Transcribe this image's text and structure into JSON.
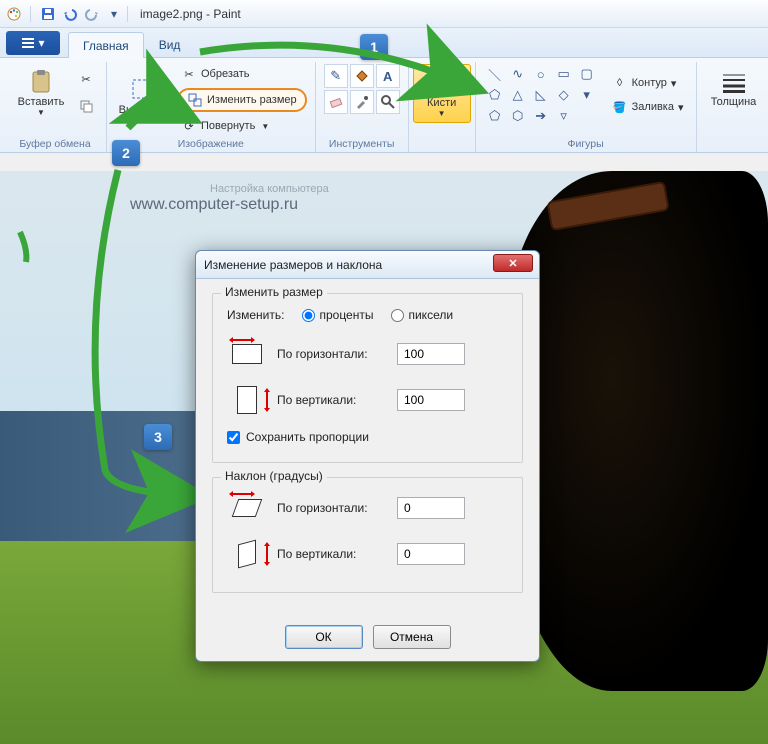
{
  "titlebar": {
    "filename": "image2.png",
    "app": "Paint"
  },
  "tabs": {
    "home": "Главная",
    "view": "Вид"
  },
  "ribbon": {
    "clipboard": {
      "paste": "Вставить",
      "group_label": "Буфер обмена"
    },
    "image": {
      "select": "Выделить",
      "crop": "Обрезать",
      "resize": "Изменить размер",
      "rotate": "Повернуть",
      "group_label": "Изображение"
    },
    "tools": {
      "group_label": "Инструменты"
    },
    "brushes": {
      "label": "Кисти"
    },
    "shapes": {
      "outline": "Контур",
      "fill": "Заливка",
      "group_label": "Фигуры"
    },
    "size": {
      "label": "Толщина"
    }
  },
  "canvas": {
    "watermark_sub": "Настройка компьютера",
    "watermark_url": "www.computer-setup.ru"
  },
  "badges": {
    "b1": "1",
    "b2": "2",
    "b3": "3"
  },
  "dialog": {
    "title": "Изменение размеров и наклона",
    "resize_box": {
      "legend": "Изменить размер",
      "by_label": "Изменить:",
      "percent": "проценты",
      "pixels": "пиксели",
      "horiz": "По горизонтали:",
      "vert": "По вертикали:",
      "val_h": "100",
      "val_v": "100",
      "keep_ratio": "Сохранить пропорции"
    },
    "skew_box": {
      "legend": "Наклон (градусы)",
      "horiz": "По горизонтали:",
      "vert": "По вертикали:",
      "val_h": "0",
      "val_v": "0"
    },
    "ok": "ОК",
    "cancel": "Отмена"
  }
}
